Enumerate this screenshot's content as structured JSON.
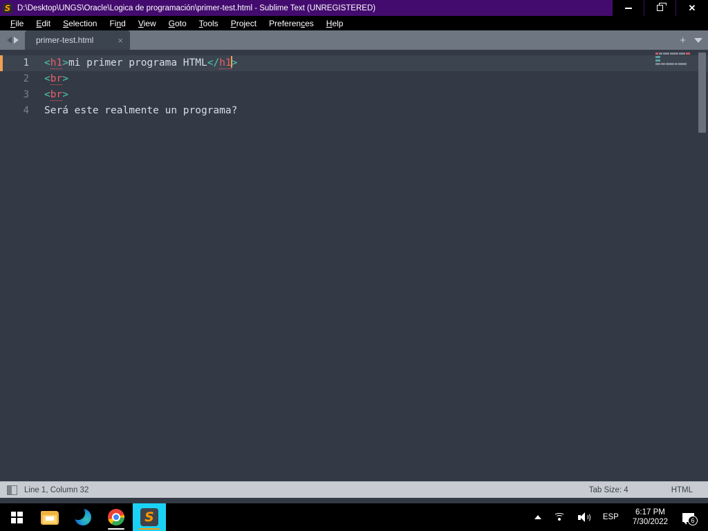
{
  "window": {
    "title": "D:\\Desktop\\UNGS\\Oracle\\Logica de programación\\primer-test.html - Sublime Text (UNREGISTERED)",
    "app_logo_letter": "S",
    "controls": {
      "minimize": "—",
      "maximize": "❐",
      "close": "✕"
    }
  },
  "menubar": {
    "items": [
      {
        "label": "File",
        "pre": "",
        "mn": "F",
        "post": "ile"
      },
      {
        "label": "Edit",
        "pre": "",
        "mn": "E",
        "post": "dit"
      },
      {
        "label": "Selection",
        "pre": "",
        "mn": "S",
        "post": "election"
      },
      {
        "label": "Find",
        "pre": "Fi",
        "mn": "n",
        "post": "d"
      },
      {
        "label": "View",
        "pre": "",
        "mn": "V",
        "post": "iew"
      },
      {
        "label": "Goto",
        "pre": "",
        "mn": "G",
        "post": "oto"
      },
      {
        "label": "Tools",
        "pre": "",
        "mn": "T",
        "post": "ools"
      },
      {
        "label": "Project",
        "pre": "",
        "mn": "P",
        "post": "roject"
      },
      {
        "label": "Preferences",
        "pre": "Preferen",
        "mn": "c",
        "post": "es"
      },
      {
        "label": "Help",
        "pre": "",
        "mn": "H",
        "post": "elp"
      }
    ]
  },
  "tabbar": {
    "tabs": [
      {
        "label": "primer-test.html",
        "close": "×",
        "active": true
      }
    ],
    "new_tab": "+",
    "dropdown": "▼"
  },
  "editor": {
    "lines": [
      {
        "number": "1",
        "text": "<h1>mi primer programa HTML</h1>",
        "active": true
      },
      {
        "number": "2",
        "text": "<br>",
        "active": false
      },
      {
        "number": "3",
        "text": "<br>",
        "active": false
      },
      {
        "number": "4",
        "text": "Será este realmente un programa?",
        "active": false
      }
    ],
    "colors": {
      "background": "#333a45",
      "active_line": "#3c4450",
      "text": "#d8dee9",
      "tag_name": "#ec5f67",
      "punctuation": "#5fb3b3",
      "line_number": "#7a828e",
      "caret": "#f0a050",
      "gutter_marker": "#f0a050"
    }
  },
  "statusbar": {
    "sidebar_toggle": "sidebar-toggle",
    "position": "Line 1, Column 32",
    "tab_size": "Tab Size: 4",
    "syntax": "HTML"
  },
  "taskbar": {
    "start": "start-button",
    "apps": [
      {
        "name": "file-explorer",
        "active": false,
        "running": false
      },
      {
        "name": "microsoft-edge",
        "active": false,
        "running": false
      },
      {
        "name": "google-chrome",
        "active": false,
        "running": true
      },
      {
        "name": "sublime-text",
        "active": true,
        "running": true,
        "letter": "S"
      }
    ],
    "tray": {
      "show_hidden": "▲",
      "network": "wifi-icon",
      "volume": "volume-icon",
      "language": "ESP",
      "time": "6:17 PM",
      "date": "7/30/2022",
      "notifications_count": "6"
    }
  }
}
